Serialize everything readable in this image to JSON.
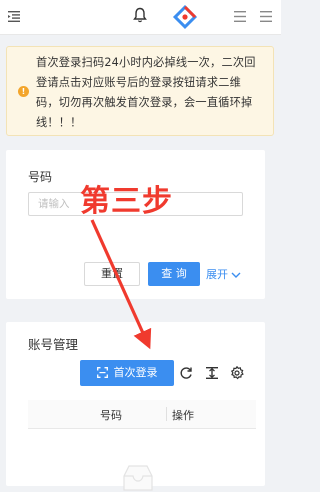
{
  "header": {
    "icons": [
      "menu-icon",
      "bell-icon",
      "logo-icon",
      "menu-icon",
      "menu-icon"
    ]
  },
  "notice": {
    "line1": "首次登录扫码24小时内必掉线一次，二次回",
    "line2": "登请点击对应账号后的登录按钮请求二维",
    "line3": "码，切勿再次触发首次登录，会一直循环掉",
    "line4": "线！！！"
  },
  "search": {
    "label": "号码",
    "placeholder": "请输入",
    "reset_label": "重置",
    "query_label": "查 询",
    "expand_label": "展开"
  },
  "accounts": {
    "title": "账号管理",
    "first_login_label": "首次登录",
    "columns": [
      "号码",
      "操作"
    ]
  },
  "annotation": {
    "step_text": "第三步",
    "color": "#f03a2e"
  },
  "colors": {
    "primary": "#3b8ef0",
    "notice_bg": "#fdf6e4",
    "warning": "#f3a52b"
  }
}
